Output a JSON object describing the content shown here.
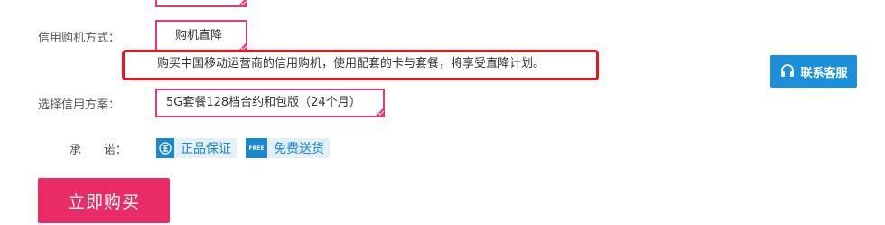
{
  "method_row": {
    "label": "信用购机方式：",
    "selected_option": "购机直降",
    "description": "购买中国移动运营商的信用购机，使用配套的卡与套餐，将享受直降计划。"
  },
  "plan_row": {
    "label": "选择信用方案：",
    "selected_option": "5G套餐128档合约和包版（24个月）"
  },
  "promise_row": {
    "label": "承      诺：",
    "items": [
      {
        "icon": "genuine-seal-icon",
        "text": "正品保证"
      },
      {
        "icon": "free-badge-icon",
        "badge_text": "FREE",
        "text": "免费送货"
      }
    ]
  },
  "customer_service": {
    "label": "联系客服",
    "icon": "headset-icon"
  },
  "buy_button": {
    "label": "立即购买"
  },
  "colors": {
    "option_border": "#e4397a",
    "highlight_border": "#e8151b",
    "accent_blue": "#1a87d1",
    "buy_button": "#ea2c66"
  }
}
